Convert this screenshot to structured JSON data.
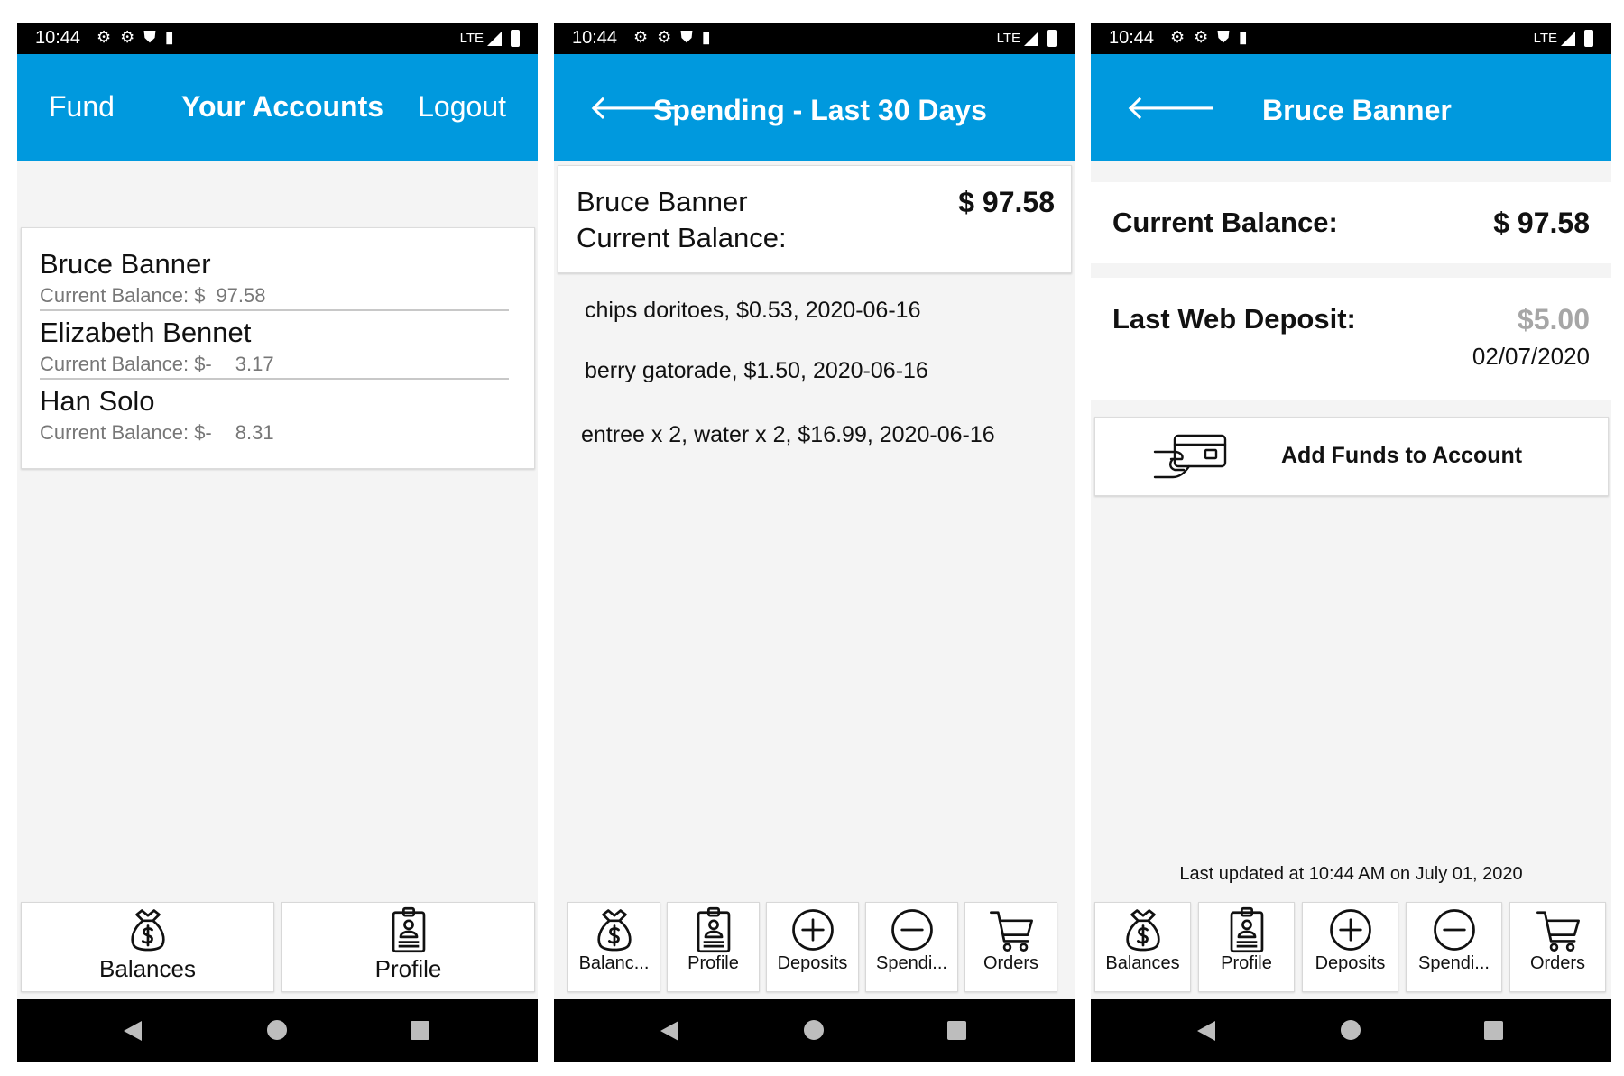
{
  "status": {
    "time": "10:44",
    "network": "LTE"
  },
  "s1": {
    "header": {
      "fund": "Fund",
      "title": "Your Accounts",
      "logout": "Logout"
    },
    "accounts": [
      {
        "name": "Bruce Banner",
        "balance_label": "Current Balance: $",
        "balance_value": "97.58"
      },
      {
        "name": "Elizabeth Bennet",
        "balance_label": "Current Balance: $-",
        "balance_value": "3.17"
      },
      {
        "name": "Han Solo",
        "balance_label": "Current Balance: $-",
        "balance_value": "8.31"
      }
    ],
    "nav": [
      {
        "label": "Balances",
        "icon": "money-bag-icon"
      },
      {
        "label": "Profile",
        "icon": "id-badge-icon"
      }
    ]
  },
  "s2": {
    "header": {
      "title": "Spending - Last 30 Days"
    },
    "card": {
      "name": "Bruce Banner",
      "balance_label": "Current Balance:",
      "amount": "$  97.58"
    },
    "transactions": [
      "chips doritoes, $0.53, 2020-06-16",
      "berry gatorade, $1.50, 2020-06-16",
      "entree x 2, water x 2, $16.99, 2020-06-16"
    ],
    "nav": [
      {
        "label": "Balanc...",
        "icon": "money-bag-icon"
      },
      {
        "label": "Profile",
        "icon": "id-badge-icon"
      },
      {
        "label": "Deposits",
        "icon": "plus-circle-icon"
      },
      {
        "label": "Spendi...",
        "icon": "minus-circle-icon"
      },
      {
        "label": "Orders",
        "icon": "cart-icon"
      }
    ]
  },
  "s3": {
    "header": {
      "title": "Bruce Banner"
    },
    "current_balance_label": "Current Balance:",
    "current_balance": "$  97.58",
    "last_deposit_label": "Last Web Deposit:",
    "last_deposit_amount": "$5.00",
    "last_deposit_date": "02/07/2020",
    "add_funds": "Add Funds to Account",
    "updated": "Last updated at 10:44 AM on July 01, 2020",
    "nav": [
      {
        "label": "Balances",
        "icon": "money-bag-icon"
      },
      {
        "label": "Profile",
        "icon": "id-badge-icon"
      },
      {
        "label": "Deposits",
        "icon": "plus-circle-icon"
      },
      {
        "label": "Spendi...",
        "icon": "minus-circle-icon"
      },
      {
        "label": "Orders",
        "icon": "cart-icon"
      }
    ]
  },
  "colors": {
    "appbar": "#0099de",
    "background": "#f4f4f4",
    "muted": "#a6a6a6"
  }
}
